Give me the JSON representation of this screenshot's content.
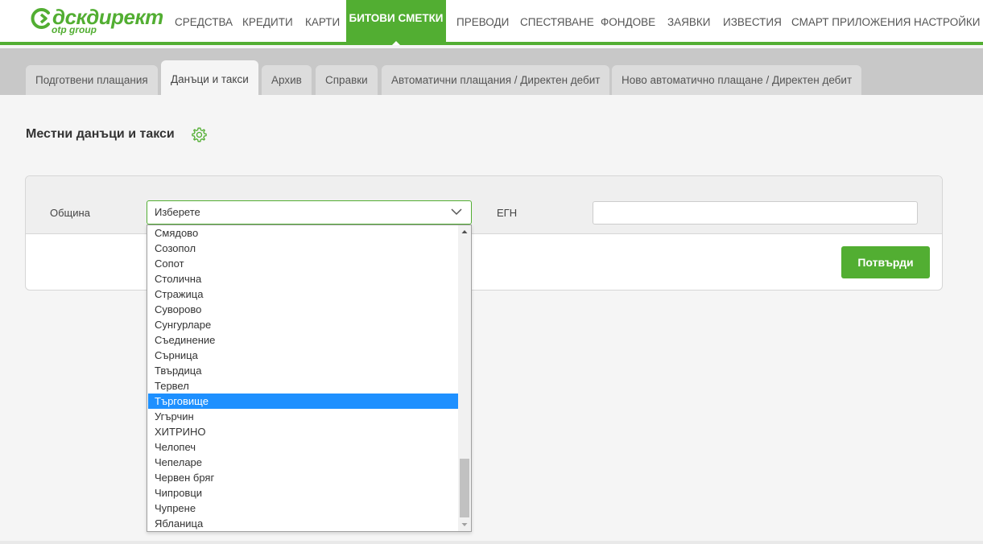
{
  "brand": {
    "name": "дскдирект",
    "sub": "otp group",
    "color": "#52ae32"
  },
  "nav": {
    "items": [
      {
        "label": "СРЕДСТВА"
      },
      {
        "label": "КРЕДИТИ"
      },
      {
        "label": "КАРТИ"
      },
      {
        "label": "БИТОВИ СМЕТКИ",
        "active": true
      },
      {
        "label": "ПРЕВОДИ"
      },
      {
        "label": "СПЕСТЯВАНЕ"
      },
      {
        "label": "ФОНДОВЕ"
      },
      {
        "label": "ЗАЯВКИ"
      },
      {
        "label": "ИЗВЕСТИЯ"
      },
      {
        "label": "СМАРТ ПРИЛОЖЕНИЯ"
      },
      {
        "label": "НАСТРОЙКИ"
      }
    ]
  },
  "subtabs": [
    {
      "label": "Подготвени плащания"
    },
    {
      "label": "Данъци и такси",
      "active": true
    },
    {
      "label": "Архив"
    },
    {
      "label": "Справки"
    },
    {
      "label": "Автоматични плащания / Директен дебит"
    },
    {
      "label": "Ново автоматично плащане / Директен дебит"
    }
  ],
  "page": {
    "title": "Местни данъци и такси",
    "settings_icon": "gear-icon"
  },
  "form": {
    "municipality_label": "Община",
    "municipality_value": "Изберете",
    "egn_label": "ЕГН",
    "egn_value": "",
    "confirm_label": "Потвърди"
  },
  "dropdown": {
    "options": [
      "Смядово",
      "Созопол",
      "Сопот",
      "Столична",
      "Стражица",
      "Суворово",
      "Сунгурларе",
      "Съединение",
      "Сърница",
      "Твърдица",
      "Тервел",
      "Търговище",
      "Угърчин",
      "ХИТРИНО",
      "Челопеч",
      "Чепеларе",
      "Червен бряг",
      "Чипровци",
      "Чупрене",
      "Ябланица"
    ],
    "highlighted": "Търговище",
    "highlight_color": "#1e90ff"
  }
}
